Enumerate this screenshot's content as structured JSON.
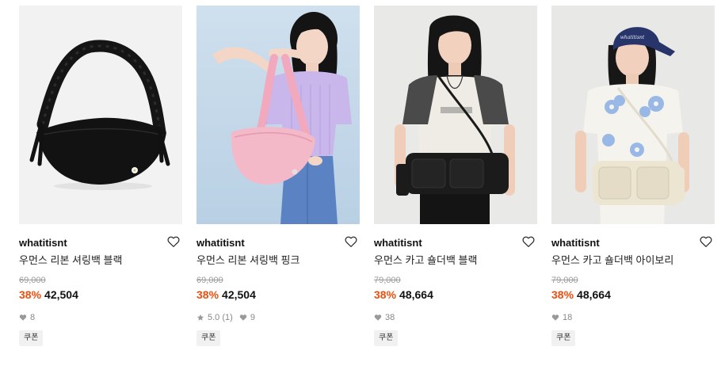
{
  "products": [
    {
      "brand": "whatitisnt",
      "name": "우먼스 리본 셔링백 블랙",
      "original_price": "69,000",
      "discount": "38%",
      "price": "42,504",
      "rating": "",
      "review_count": "",
      "likes": "8",
      "coupon": "쿠폰",
      "image": "black-ruched-shoulder-bag"
    },
    {
      "brand": "whatitisnt",
      "name": "우먼스 리본 셔링백 핑크",
      "original_price": "69,000",
      "discount": "38%",
      "price": "42,504",
      "rating": "5.0",
      "review_count": "(1)",
      "likes": "9",
      "coupon": "쿠폰",
      "image": "model-with-pink-bag"
    },
    {
      "brand": "whatitisnt",
      "name": "우먼스 카고 숄더백 블랙",
      "original_price": "79,000",
      "discount": "38%",
      "price": "48,664",
      "rating": "",
      "review_count": "",
      "likes": "38",
      "coupon": "쿠폰",
      "image": "model-with-black-cargo-bag"
    },
    {
      "brand": "whatitisnt",
      "name": "우먼스 카고 숄더백 아이보리",
      "original_price": "79,000",
      "discount": "38%",
      "price": "48,664",
      "rating": "",
      "review_count": "",
      "likes": "18",
      "coupon": "쿠폰",
      "image": "model-with-ivory-cargo-bag"
    }
  ],
  "colors": {
    "discount": "#f04e0e",
    "meta": "#888888",
    "coupon_bg": "#f1f1f1"
  }
}
